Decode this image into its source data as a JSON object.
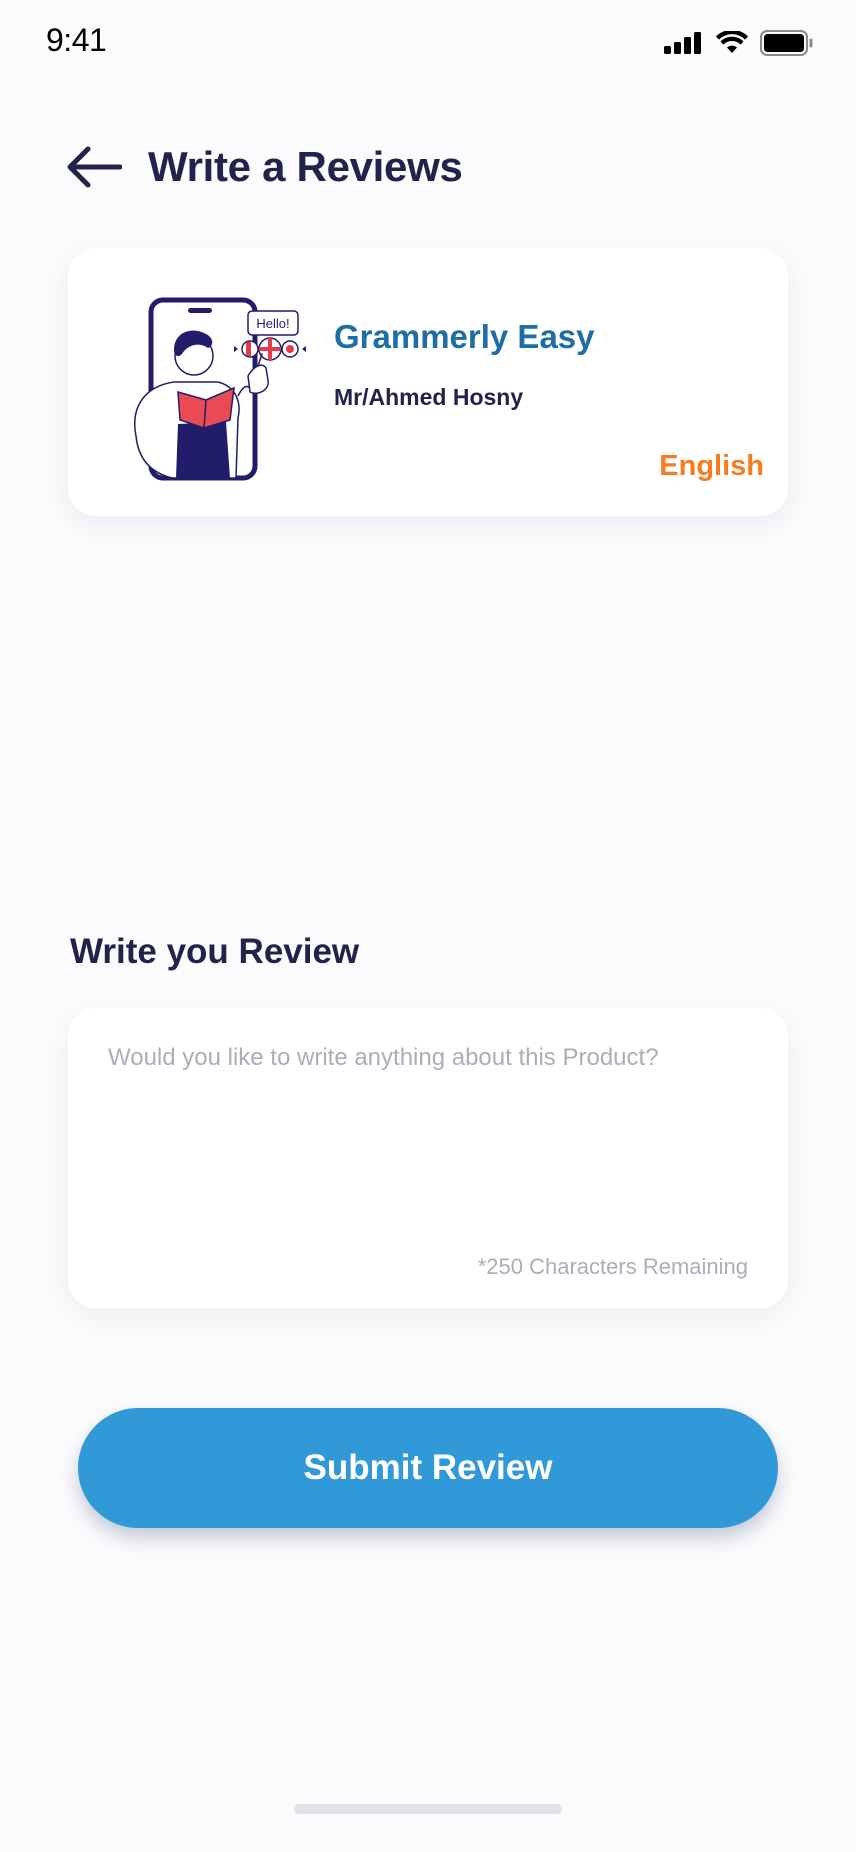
{
  "status_bar": {
    "time": "9:41"
  },
  "header": {
    "title": "Write a Reviews",
    "back_icon": "arrow-left-icon"
  },
  "course": {
    "title": "Grammerly Easy",
    "instructor": "Mr/Ahmed Hosny",
    "language": "English",
    "illustration_text": "Hello!",
    "colors": {
      "title": "#1c6ea4",
      "language": "#f57c1f"
    }
  },
  "review": {
    "section_title": "Write you Review",
    "placeholder": "Would you like to write anything about this Product?",
    "value": "",
    "counter_text": "*250 Characters Remaining"
  },
  "actions": {
    "submit_label": "Submit Review",
    "submit_color": "#3199d8"
  }
}
